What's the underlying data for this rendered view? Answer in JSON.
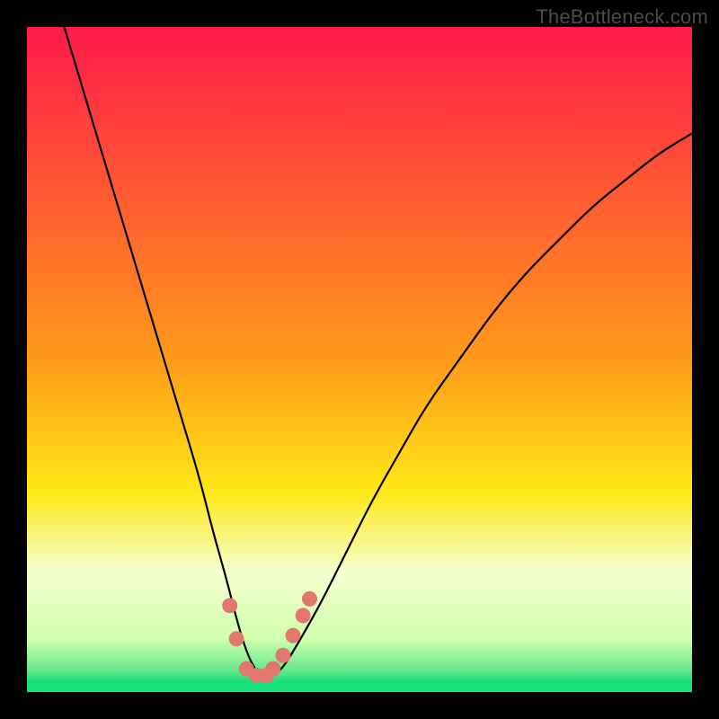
{
  "watermark": "TheBottleneck.com",
  "colors": {
    "frame": "#000000",
    "top": "#ff1a4a",
    "yellow": "#ffe816",
    "pale": "#f6ffd0",
    "green": "#18e07a",
    "curve": "#000000",
    "markers": "#e2776f"
  },
  "chart_data": {
    "type": "line",
    "title": "",
    "xlabel": "",
    "ylabel": "",
    "xlim": [
      0,
      100
    ],
    "ylim": [
      0,
      100
    ],
    "series": [
      {
        "name": "bottleneck-curve",
        "x": [
          0,
          2,
          5,
          8,
          11,
          14,
          17,
          20,
          23,
          26,
          28,
          30,
          31.5,
          33,
          34.5,
          36,
          38,
          40,
          44,
          48,
          52,
          56,
          60,
          65,
          70,
          75,
          80,
          85,
          90,
          95,
          100
        ],
        "y": [
          118,
          112,
          102,
          92,
          82,
          72,
          62,
          52,
          42,
          32,
          24,
          17,
          11,
          6,
          3,
          2,
          3,
          6,
          13,
          21,
          29,
          36,
          43,
          50,
          57,
          63,
          68,
          73,
          77,
          81,
          84
        ]
      }
    ],
    "markers": {
      "name": "highlight-points",
      "x": [
        30.5,
        31.5,
        33,
        34.5,
        36,
        37.0,
        38.5,
        40.0,
        41.5,
        42.5
      ],
      "y": [
        13,
        8,
        3.5,
        2.5,
        2.5,
        3.5,
        5.5,
        8.5,
        11.5,
        14
      ]
    },
    "gradient_stops": [
      {
        "offset": 0,
        "color": "#ff1a4a"
      },
      {
        "offset": 0.5,
        "color": "#ff9a1a"
      },
      {
        "offset": 0.7,
        "color": "#ffe816"
      },
      {
        "offset": 0.82,
        "color": "#f6ffd0"
      },
      {
        "offset": 0.92,
        "color": "#cfffad"
      },
      {
        "offset": 0.965,
        "color": "#6fe890"
      },
      {
        "offset": 0.985,
        "color": "#18e07a"
      },
      {
        "offset": 1.0,
        "color": "#18e07a"
      }
    ]
  }
}
